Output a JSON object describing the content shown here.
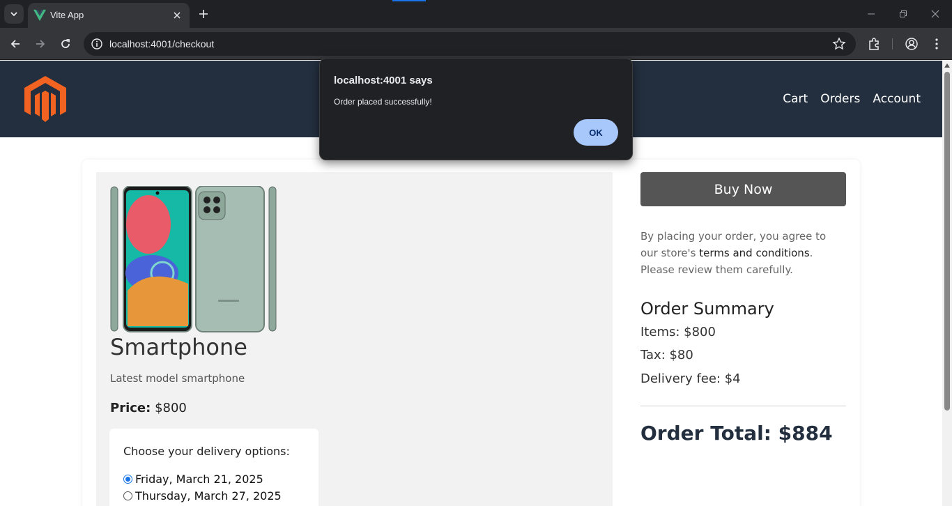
{
  "browser": {
    "tab_title": "Vite App",
    "url": "localhost:4001/checkout"
  },
  "header": {
    "nav": [
      "Cart",
      "Orders",
      "Account"
    ]
  },
  "product": {
    "name": "Smartphone",
    "description": "Latest model smartphone",
    "price_label": "Price:",
    "price_value": "$800"
  },
  "delivery": {
    "title": "Choose your delivery options:",
    "options": [
      {
        "label": "Friday, March 21, 2025",
        "selected": true
      },
      {
        "label": "Thursday, March 27, 2025",
        "selected": false
      }
    ]
  },
  "summary": {
    "buy_button": "Buy Now",
    "terms_pre": "By placing your order, you agree to our store's ",
    "terms_link": "terms and conditions",
    "terms_post": ". Please review them carefully.",
    "title": "Order Summary",
    "items": "Items: $800",
    "tax": "Tax: $80",
    "delivery_fee": "Delivery fee: $4",
    "total": "Order Total: $884"
  },
  "dialog": {
    "title": "localhost:4001 says",
    "message": "Order placed successfully!",
    "ok_label": "OK"
  },
  "colors": {
    "header_bg": "#232f3e",
    "logo": "#f26322",
    "buy_button": "#555555",
    "dialog_ok": "#a8c7fa"
  }
}
